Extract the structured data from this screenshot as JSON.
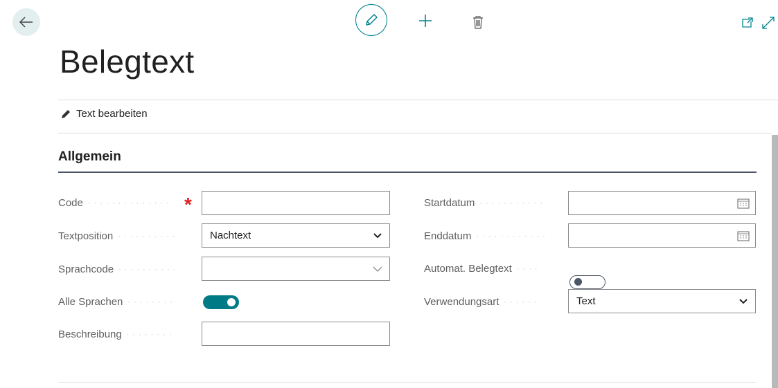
{
  "page": {
    "title": "Belegtext"
  },
  "actions": {
    "edit_text_label": "Text bearbeiten"
  },
  "section": {
    "title": "Allgemein"
  },
  "left_fields": {
    "code": {
      "label": "Code",
      "value": "",
      "required_mark": "*"
    },
    "textposition": {
      "label": "Textposition",
      "value": "Nachtext"
    },
    "sprachcode": {
      "label": "Sprachcode",
      "value": ""
    },
    "alle_sprachen": {
      "label": "Alle Sprachen",
      "value": true
    },
    "beschreibung": {
      "label": "Beschreibung",
      "value": ""
    }
  },
  "right_fields": {
    "startdatum": {
      "label": "Startdatum",
      "value": ""
    },
    "enddatum": {
      "label": "Enddatum",
      "value": ""
    },
    "automat_belegtext": {
      "label": "Automat. Belegtext",
      "value": false
    },
    "verwendungsart": {
      "label": "Verwendungsart",
      "value": "Text"
    }
  },
  "colors": {
    "accent": "#00838f",
    "toggle_on": "#007a85",
    "required": "#e02020"
  },
  "icons": [
    "back-arrow-icon",
    "pencil-icon",
    "plus-icon",
    "trash-icon",
    "open-in-new-window-icon",
    "expand-icon",
    "calendar-icon",
    "chevron-down-icon"
  ]
}
